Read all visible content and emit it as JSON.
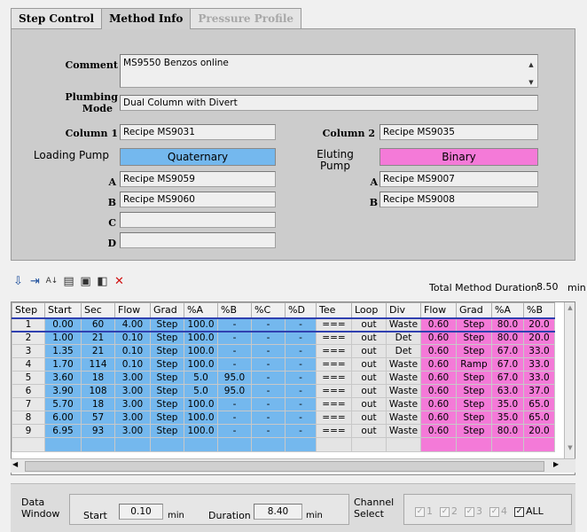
{
  "tabs": [
    {
      "label": "Step Control"
    },
    {
      "label": "Method Info"
    },
    {
      "label": "Pressure Profile"
    }
  ],
  "method_info": {
    "comment_label": "Comment",
    "comment_value": "MS9550 Benzos online",
    "plumbing_label_1": "Plumbing",
    "plumbing_label_2": "Mode",
    "plumbing_value": "Dual Column with Divert",
    "column1_label": "Column 1",
    "column1_value": "Recipe MS9031",
    "column2_label": "Column 2",
    "column2_value": "Recipe MS9035",
    "loading_pump_label": "Loading Pump",
    "loading_pump_value": "Quaternary",
    "eluting_pump_label_1": "Eluting",
    "eluting_pump_label_2": "Pump",
    "eluting_pump_value": "Binary",
    "loading": {
      "a_label": "A",
      "a_value": "Recipe MS9059",
      "b_label": "B",
      "b_value": "Recipe MS9060",
      "c_label": "C",
      "c_value": "",
      "d_label": "D",
      "d_value": ""
    },
    "eluting": {
      "a_label": "A",
      "a_value": "Recipe MS9007",
      "b_label": "B",
      "b_value": "Recipe MS9008"
    }
  },
  "toolbar": {
    "total_duration_label": "Total Method Duration",
    "total_duration_value": "8.50",
    "total_duration_unit": "min"
  },
  "grid": {
    "headers": [
      "Step",
      "Start",
      "Sec",
      "Flow",
      "Grad",
      "%A",
      "%B",
      "%C",
      "%D",
      "Tee",
      "Loop",
      "Div",
      "Flow",
      "Grad",
      "%A",
      "%B"
    ],
    "rows": [
      [
        "1",
        "0.00",
        "60",
        "4.00",
        "Step",
        "100.0",
        "-",
        "-",
        "-",
        "===",
        "out",
        "Waste",
        "0.60",
        "Step",
        "80.0",
        "20.0"
      ],
      [
        "2",
        "1.00",
        "21",
        "0.10",
        "Step",
        "100.0",
        "-",
        "-",
        "-",
        "===",
        "out",
        "Det",
        "0.60",
        "Step",
        "80.0",
        "20.0"
      ],
      [
        "3",
        "1.35",
        "21",
        "0.10",
        "Step",
        "100.0",
        "-",
        "-",
        "-",
        "===",
        "out",
        "Det",
        "0.60",
        "Step",
        "67.0",
        "33.0"
      ],
      [
        "4",
        "1.70",
        "114",
        "0.10",
        "Step",
        "100.0",
        "-",
        "-",
        "-",
        "===",
        "out",
        "Waste",
        "0.60",
        "Ramp",
        "67.0",
        "33.0"
      ],
      [
        "5",
        "3.60",
        "18",
        "3.00",
        "Step",
        "5.0",
        "95.0",
        "-",
        "-",
        "===",
        "out",
        "Waste",
        "0.60",
        "Step",
        "67.0",
        "33.0"
      ],
      [
        "6",
        "3.90",
        "108",
        "3.00",
        "Step",
        "5.0",
        "95.0",
        "-",
        "-",
        "===",
        "out",
        "Waste",
        "0.60",
        "Step",
        "63.0",
        "37.0"
      ],
      [
        "7",
        "5.70",
        "18",
        "3.00",
        "Step",
        "100.0",
        "-",
        "-",
        "-",
        "===",
        "out",
        "Waste",
        "0.60",
        "Step",
        "35.0",
        "65.0"
      ],
      [
        "8",
        "6.00",
        "57",
        "3.00",
        "Step",
        "100.0",
        "-",
        "-",
        "-",
        "===",
        "out",
        "Waste",
        "0.60",
        "Step",
        "35.0",
        "65.0"
      ],
      [
        "9",
        "6.95",
        "93",
        "3.00",
        "Step",
        "100.0",
        "-",
        "-",
        "-",
        "===",
        "out",
        "Waste",
        "0.60",
        "Step",
        "80.0",
        "20.0"
      ]
    ]
  },
  "bottom": {
    "data_window_label_1": "Data",
    "data_window_label_2": "Window",
    "start_label": "Start",
    "start_value": "0.10",
    "start_unit": "min",
    "duration_label": "Duration",
    "duration_value": "8.40",
    "duration_unit": "min",
    "channel_label_1": "Channel",
    "channel_label_2": "Select",
    "channels": [
      {
        "label": "1",
        "checked": true,
        "enabled": false
      },
      {
        "label": "2",
        "checked": true,
        "enabled": false
      },
      {
        "label": "3",
        "checked": true,
        "enabled": false
      },
      {
        "label": "4",
        "checked": true,
        "enabled": false
      },
      {
        "label": "ALL",
        "checked": true,
        "enabled": true
      }
    ]
  },
  "colors": {
    "loading_pump": "#74b8ee",
    "eluting_pump": "#f47ad8",
    "selection": "#3040b0"
  },
  "icons": [
    "add-step-icon",
    "insert-step-icon",
    "sort-icon",
    "copy-icon",
    "paste-icon",
    "save-icon",
    "delete-icon"
  ]
}
